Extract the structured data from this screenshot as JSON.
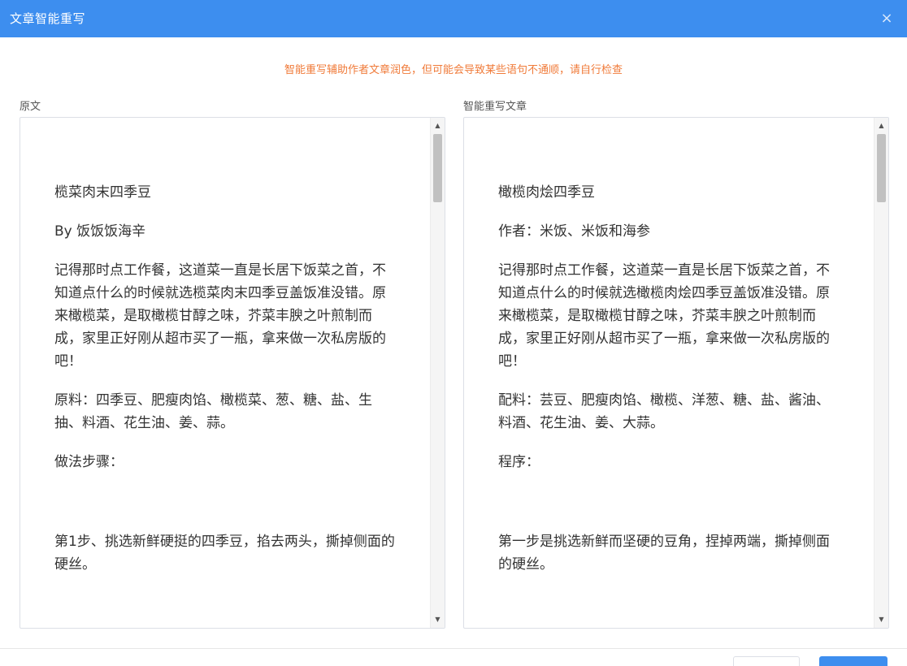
{
  "dialog": {
    "title": "文章智能重写",
    "close_icon": "×",
    "notice": "智能重写辅助作者文章润色，但可能会导致某些语句不通顺，请自行检查",
    "colors": {
      "header": "#3d8eef",
      "notice": "#f07b3a"
    }
  },
  "original": {
    "label": "原文",
    "paragraphs": [
      "榄菜肉末四季豆",
      "By 饭饭饭海辛",
      "记得那时点工作餐，这道菜一直是长居下饭菜之首，不知道点什么的时候就选榄菜肉末四季豆盖饭准没错。原来橄榄菜，是取橄榄甘醇之味，芥菜丰腴之叶煎制而成，家里正好刚从超市买了一瓶，拿来做一次私房版的吧！",
      "原料：四季豆、肥瘦肉馅、橄榄菜、葱、糖、盐、生抽、料酒、花生油、姜、蒜。",
      "做法步骤：",
      "第1步、挑选新鲜硬挺的四季豆，掐去两头，撕掉侧面的硬丝。"
    ]
  },
  "rewritten": {
    "label": "智能重写文章",
    "paragraphs": [
      "橄榄肉烩四季豆",
      "作者：米饭、米饭和海参",
      "记得那时点工作餐，这道菜一直是长居下饭菜之首，不知道点什么的时候就选橄榄肉烩四季豆盖饭准没错。原来橄榄菜，是取橄榄甘醇之味，芥菜丰腴之叶煎制而成，家里正好刚从超市买了一瓶，拿来做一次私房版的吧！",
      "配料：芸豆、肥瘦肉馅、橄榄、洋葱、糖、盐、酱油、料酒、花生油、姜、大蒜。",
      "程序：",
      "第一步是挑选新鲜而坚硬的豆角，捏掉两端，撕掉侧面的硬丝。"
    ]
  },
  "scrollbar": {
    "up_arrow": "▲",
    "down_arrow": "▼"
  }
}
